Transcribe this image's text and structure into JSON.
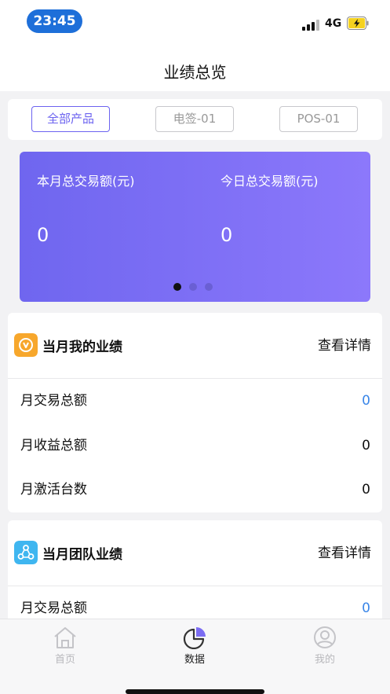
{
  "status_bar": {
    "time": "23:45",
    "network": "4G"
  },
  "nav": {
    "title": "业绩总览"
  },
  "tabs": [
    {
      "label": "全部产品",
      "active": true
    },
    {
      "label": "电签-01",
      "active": false
    },
    {
      "label": "POS-01",
      "active": false
    }
  ],
  "banner": {
    "monthly_label": "本月总交易额(元)",
    "monthly_value": "0",
    "daily_label": "今日总交易额(元)",
    "daily_value": "0",
    "page_count": 3,
    "active_page": 1
  },
  "my_performance": {
    "title": "当月我的业绩",
    "detail_link": "查看详情",
    "rows": [
      {
        "label": "月交易总额",
        "value": "0"
      },
      {
        "label": "月收益总额",
        "value": "0"
      },
      {
        "label": "月激活台数",
        "value": "0"
      }
    ]
  },
  "team_performance": {
    "title": "当月团队业绩",
    "detail_link": "查看详情",
    "rows": [
      {
        "label": "月交易总额",
        "value": "0"
      }
    ]
  },
  "tabbar": {
    "items": [
      {
        "label": "首页",
        "icon": "home-icon",
        "active": false
      },
      {
        "label": "数据",
        "icon": "chart-icon",
        "active": true
      },
      {
        "label": "我的",
        "icon": "user-icon",
        "active": false
      }
    ]
  },
  "colors": {
    "accent": "#6c63f0",
    "link_blue": "#3a86e8",
    "banner_start": "#6f66ef",
    "banner_end": "#8c78fb"
  }
}
